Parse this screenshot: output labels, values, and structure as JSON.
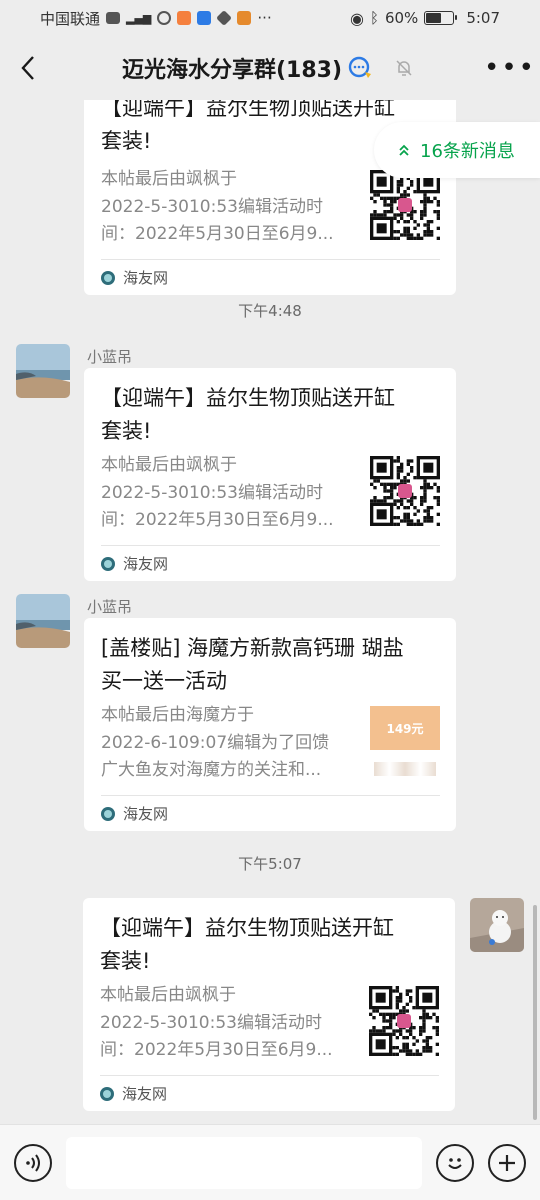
{
  "status": {
    "carrier": "中国联通",
    "battery": "60%",
    "battery_level": 0.6,
    "time": "5:07"
  },
  "header": {
    "title": "迈光海水分享群(183)"
  },
  "new_messages": "16条新消息",
  "messages": [
    {
      "title_partial": "【迎端午】益尔生物顶贴送开缸",
      "title": "套装!",
      "desc": [
        "本帖最后由飒枫于",
        "2022-5-3010:53编辑活动时",
        "间：2022年5月30日至6月9..."
      ],
      "source": "海友网"
    },
    {
      "time": "下午4:48",
      "sender": "小蓝吊",
      "title": "【迎端午】益尔生物顶贴送开缸套装!",
      "title_l1": "【迎端午】益尔生物顶贴送开缸",
      "title_l2": "套装!",
      "desc": [
        "本帖最后由飒枫于",
        "2022-5-3010:53编辑活动时",
        "间：2022年5月30日至6月9..."
      ],
      "source": "海友网"
    },
    {
      "sender": "小蓝吊",
      "title_l1": "[盖楼贴] 海魔方新款高钙珊 瑚盐",
      "title_l2": "买一送一活动",
      "desc": [
        "本帖最后由海魔方于",
        "2022-6-109:07编辑为了回馈",
        "广大鱼友对海魔方的关注和..."
      ],
      "thumb_text": "149元",
      "source": "海友网"
    },
    {
      "time": "下午5:07",
      "title_l1": "【迎端午】益尔生物顶贴送开缸",
      "title_l2": "套装!",
      "desc": [
        "本帖最后由飒枫于",
        "2022-5-3010:53编辑活动时",
        "间：2022年5月30日至6月9..."
      ],
      "source": "海友网"
    }
  ]
}
